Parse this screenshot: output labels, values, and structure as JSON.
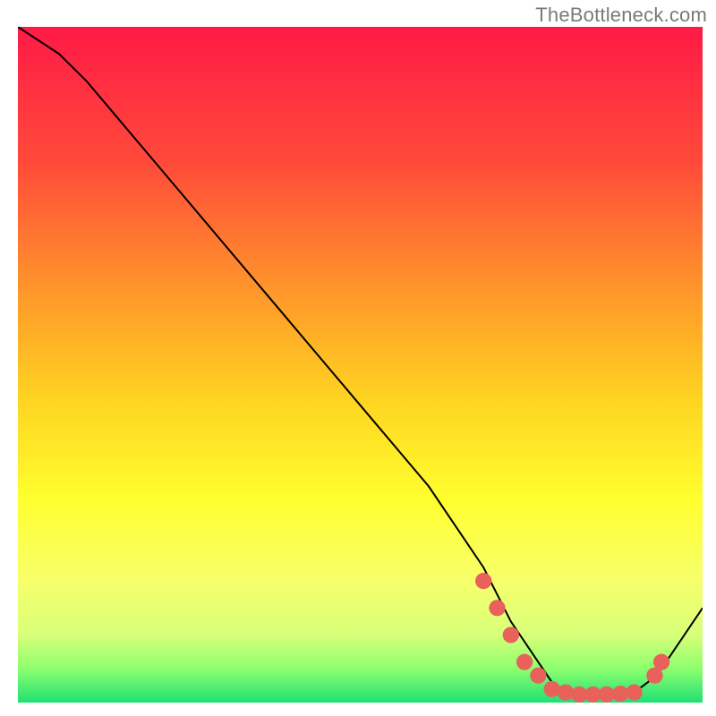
{
  "watermark": "TheBottleneck.com",
  "chart_data": {
    "type": "line",
    "title": "",
    "xlabel": "",
    "ylabel": "",
    "xlim": [
      0,
      100
    ],
    "ylim": [
      0,
      100
    ],
    "series": [
      {
        "name": "curve",
        "x": [
          0,
          6,
          10,
          20,
          30,
          40,
          50,
          60,
          68,
          72,
          76,
          78,
          80,
          82,
          84,
          86,
          88,
          90,
          92,
          94,
          96,
          98,
          100
        ],
        "y": [
          100,
          96,
          92,
          80,
          68,
          56,
          44,
          32,
          20,
          12,
          6,
          3,
          1.5,
          1,
          1,
          1,
          1,
          1.5,
          3,
          5,
          8,
          11,
          14
        ]
      },
      {
        "name": "dots",
        "x": [
          68,
          70,
          72,
          74,
          76,
          78,
          80,
          82,
          84,
          86,
          88,
          90,
          93,
          94
        ],
        "y": [
          18,
          14,
          10,
          6,
          4,
          2,
          1.5,
          1.2,
          1.2,
          1.2,
          1.3,
          1.5,
          4,
          6
        ]
      }
    ],
    "gradient_stops": [
      {
        "offset": 0.0,
        "color": "#ff1a46"
      },
      {
        "offset": 0.2,
        "color": "#ff4a3a"
      },
      {
        "offset": 0.4,
        "color": "#ff9a2a"
      },
      {
        "offset": 0.55,
        "color": "#ffd321"
      },
      {
        "offset": 0.7,
        "color": "#ffff2f"
      },
      {
        "offset": 0.82,
        "color": "#f7ff6b"
      },
      {
        "offset": 0.9,
        "color": "#d8ff7a"
      },
      {
        "offset": 0.95,
        "color": "#8cff6e"
      },
      {
        "offset": 1.0,
        "color": "#1fe074"
      }
    ],
    "dot_color": "#e8615b",
    "curve_color": "#000000"
  }
}
